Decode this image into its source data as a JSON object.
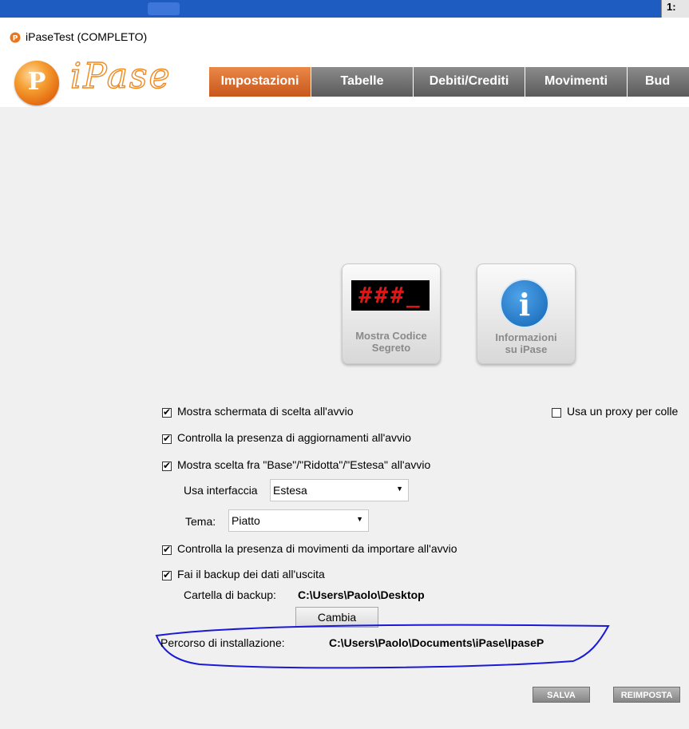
{
  "taskbar": {
    "corner_glyph": "1:"
  },
  "window": {
    "title": "iPaseTest (COMPLETO)"
  },
  "brand": {
    "logo_letter": "P",
    "wordmark": "iPase"
  },
  "menu": {
    "items": [
      {
        "label": "Impostazioni",
        "active": true
      },
      {
        "label": "Tabelle",
        "active": false
      },
      {
        "label": "Debiti/Crediti",
        "active": false
      },
      {
        "label": "Movimenti",
        "active": false
      },
      {
        "label": "Bud",
        "active": false
      }
    ]
  },
  "tiles": {
    "secret_code": {
      "display": "###_",
      "label_line1": "Mostra Codice",
      "label_line2": "Segreto"
    },
    "info": {
      "glyph": "i",
      "label_line1": "Informazioni",
      "label_line2": "su iPase"
    }
  },
  "options": {
    "show_choice_screen": {
      "label": "Mostra schermata di scelta all'avvio",
      "checked": true
    },
    "use_proxy": {
      "label": "Usa un proxy per colle",
      "checked": false
    },
    "check_updates": {
      "label": "Controlla la presenza di aggiornamenti all'avvio",
      "checked": true
    },
    "show_mode_choice": {
      "label": "Mostra scelta fra \"Base\"/\"Ridotta\"/\"Estesa\" all'avvio",
      "checked": true
    },
    "check_movements": {
      "label": "Controlla la presenza di movimenti da importare all'avvio",
      "checked": true
    },
    "backup_on_exit": {
      "label": "Fai il backup dei dati all'uscita",
      "checked": true
    }
  },
  "interface": {
    "label": "Usa interfaccia",
    "value": "Estesa"
  },
  "theme": {
    "label": "Tema:",
    "value": "Piatto"
  },
  "backup": {
    "label": "Cartella di backup:",
    "path": "C:\\Users\\Paolo\\Desktop",
    "change_button": "Cambia"
  },
  "install": {
    "label": "Percorso di installazione:",
    "path": "C:\\Users\\Paolo\\Documents\\iPase\\IpaseP"
  },
  "actions": {
    "save": "SALVA",
    "reset": "REIMPOSTA"
  },
  "colors": {
    "accent": "#d9692a",
    "menu_bg": "#6b6b6b",
    "annotation": "#1a1ad6"
  }
}
